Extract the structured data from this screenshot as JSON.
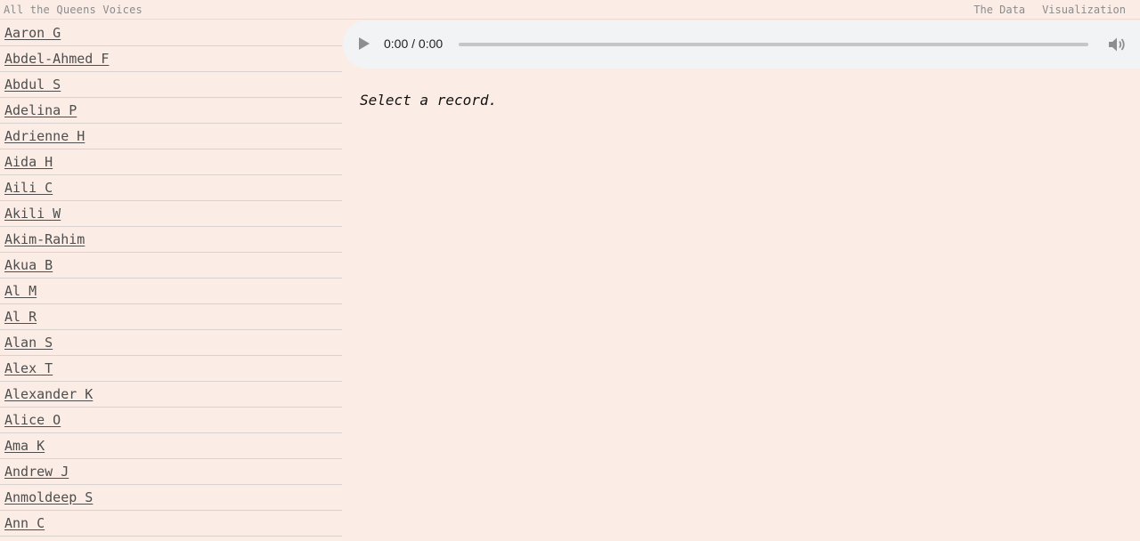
{
  "header": {
    "site_title": "All the Queens Voices",
    "nav": [
      "The Data",
      "Visualization"
    ]
  },
  "sidebar": {
    "records": [
      "Aaron G",
      "Abdel-Ahmed F",
      "Abdul S",
      "Adelina P",
      "Adrienne H",
      "Aida H",
      "Aili C",
      "Akili W",
      "Akim-Rahim",
      "Akua B",
      "Al M",
      "Al R",
      "Alan S",
      "Alex T",
      "Alexander K",
      "Alice O",
      "Ama K",
      "Andrew J",
      "Anmoldeep S",
      "Ann C"
    ]
  },
  "player": {
    "time": "0:00 / 0:00",
    "icons": [
      "play-icon",
      "volume-icon"
    ]
  },
  "main": {
    "prompt": "Select a record."
  },
  "colors": {
    "background": "#fbede5",
    "player_bg": "#f1f3f4"
  }
}
